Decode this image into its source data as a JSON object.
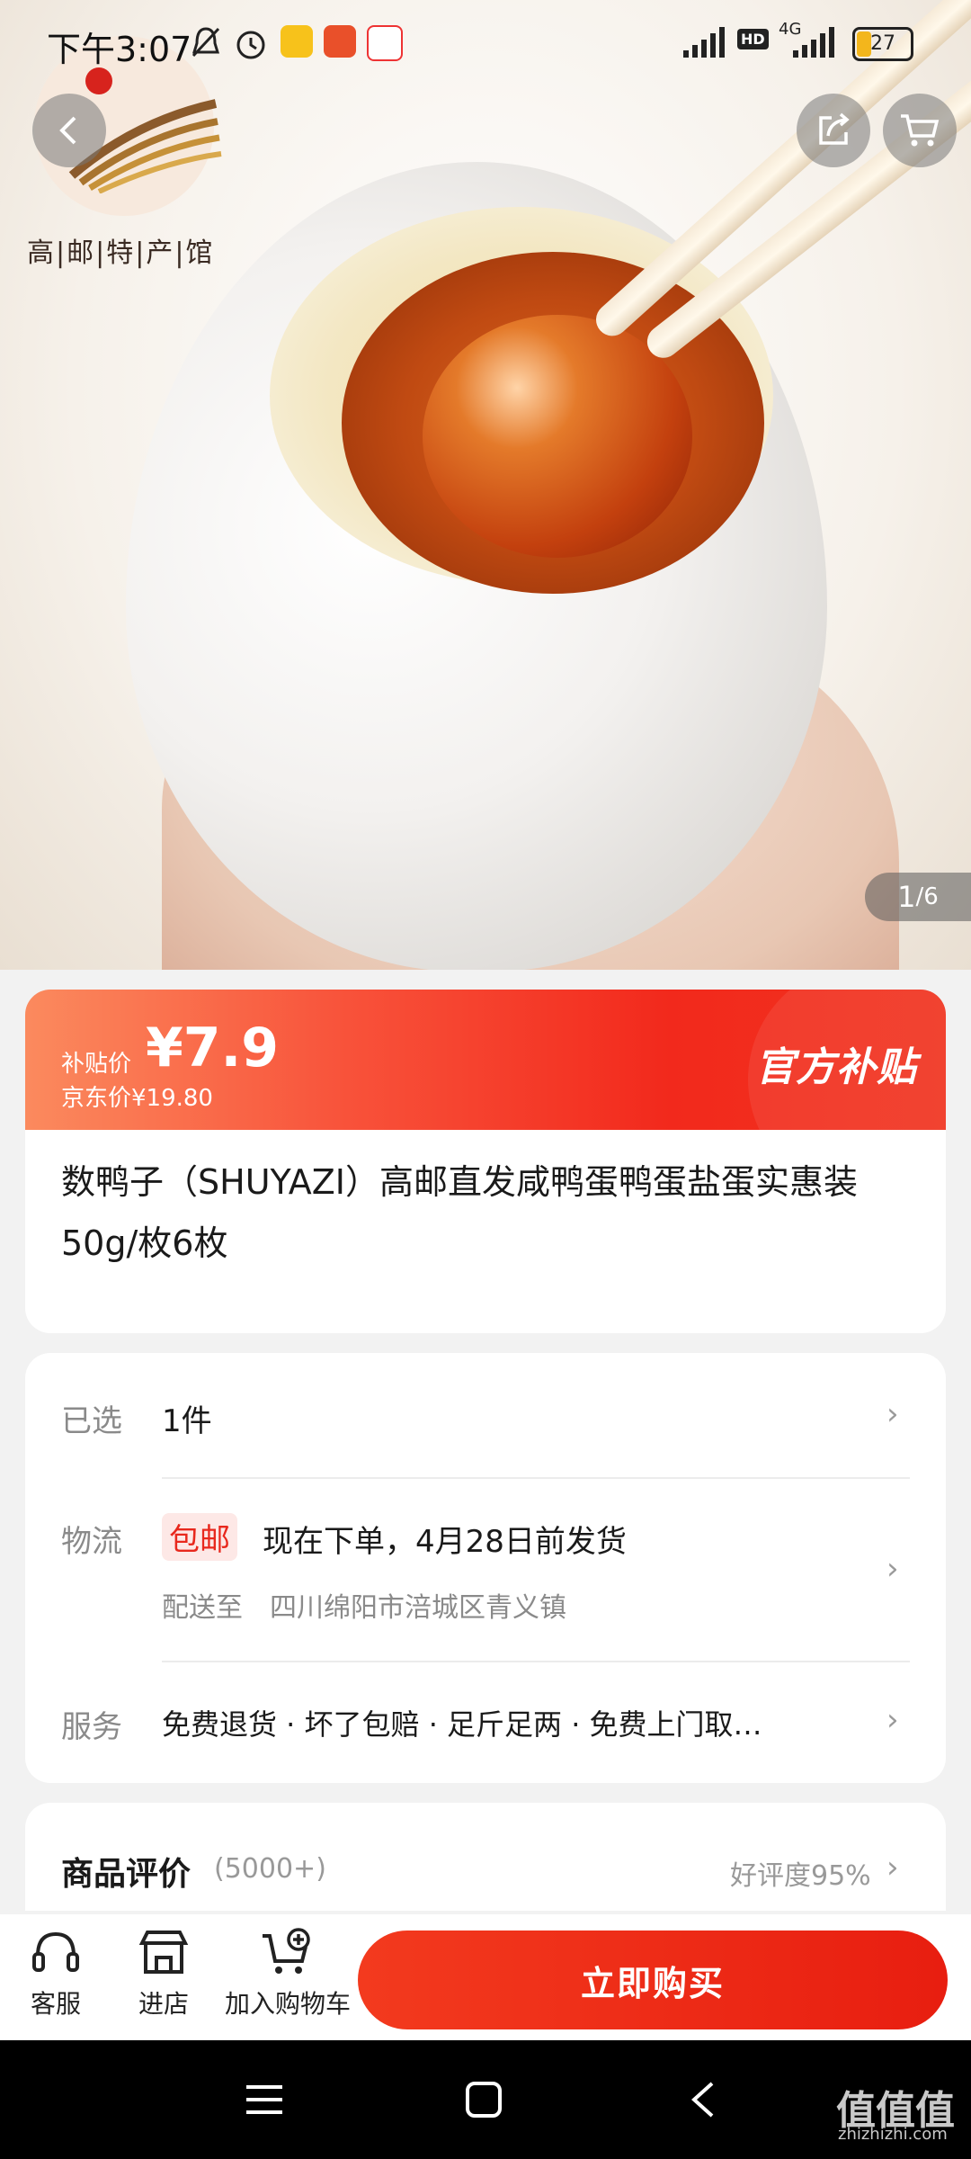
{
  "status_bar": {
    "time": "下午3:07",
    "network": "4G",
    "hd": "HD",
    "battery": "27"
  },
  "hero": {
    "store_logo_text": "高|邮|特|产|馆",
    "image_index": "1",
    "image_total": "/6",
    "icons": [
      "back-icon",
      "share-icon",
      "cart-icon"
    ]
  },
  "price": {
    "subsidy_label": "补贴价",
    "subsidy_price": "¥7.9",
    "jd_price": "京东价¥19.80",
    "official_tag": "官方补贴",
    "accent_color": "#f2291c"
  },
  "product": {
    "title": "数鸭子（SHUYAZI）高邮直发咸鸭蛋鸭蛋盐蛋实惠装50g/枚6枚"
  },
  "info": {
    "selected_label": "已选",
    "selected_value": "1件",
    "logistics_label": "物流",
    "free_shipping": "包邮",
    "ship_time": "现在下单，4月28日前发货",
    "deliver_prefix": "配送至",
    "deliver_address": "四川绵阳市涪城区青义镇",
    "service_label": "服务",
    "service_value": "免费退货 · 坏了包赔 · 足斤足两 · 免费上门取…"
  },
  "reviews": {
    "title": "商品评价",
    "count": "(5000+)",
    "rating": "好评度95%"
  },
  "bottom_bar": {
    "service": "客服",
    "store": "进店",
    "add_cart": "加入购物车",
    "buy_now": "立即购买"
  },
  "watermark": {
    "text": "值值值",
    "url": "zhizhizhi.com"
  }
}
